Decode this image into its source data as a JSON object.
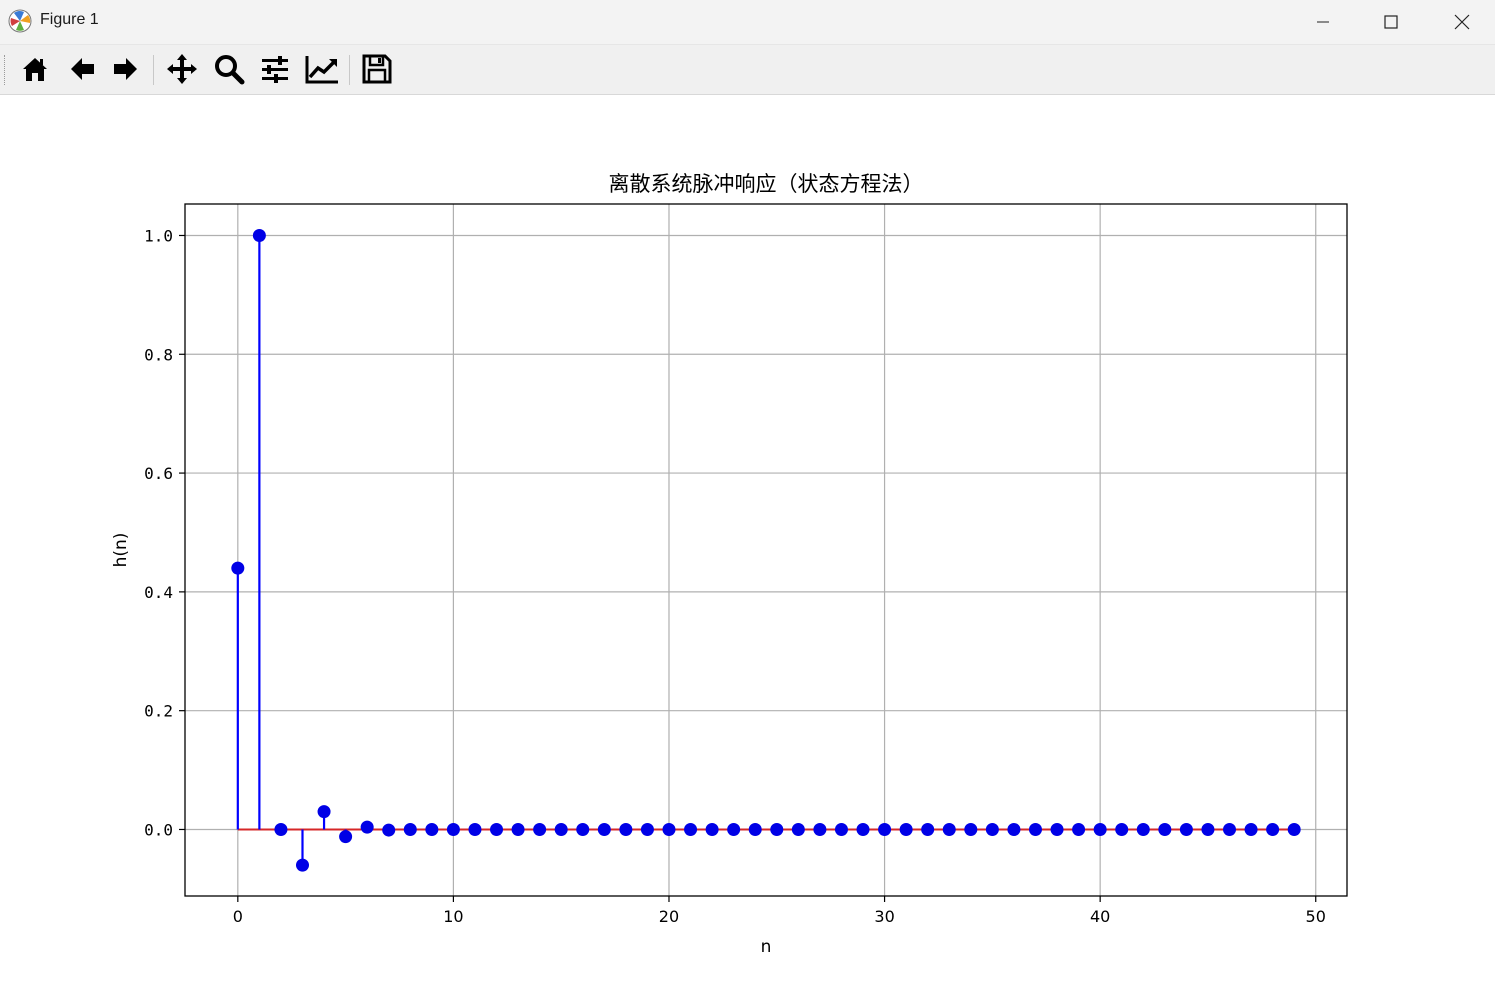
{
  "window": {
    "title": "Figure 1"
  },
  "toolbar": {
    "buttons": [
      {
        "name": "home-icon"
      },
      {
        "name": "back-arrow-icon"
      },
      {
        "name": "forward-arrow-icon"
      },
      {
        "name": "pan-move-icon"
      },
      {
        "name": "zoom-magnifier-icon"
      },
      {
        "name": "configure-subplots-icon"
      },
      {
        "name": "edit-axis-icon"
      },
      {
        "name": "save-floppy-icon"
      }
    ]
  },
  "chart_data": {
    "type": "stem",
    "title": "离散系统脉冲响应（状态方程法）",
    "xlabel": "n",
    "ylabel": "h(n)",
    "xlim": [
      -2.45,
      51.45
    ],
    "ylim": [
      -0.112,
      1.053
    ],
    "xticks": [
      0,
      10,
      20,
      30,
      40,
      50
    ],
    "xtick_labels": [
      "0",
      "10",
      "20",
      "30",
      "40",
      "50"
    ],
    "yticks": [
      0.0,
      0.2,
      0.4,
      0.6,
      0.8,
      1.0
    ],
    "ytick_labels": [
      "0.0",
      "0.2",
      "0.4",
      "0.6",
      "0.8",
      "1.0"
    ],
    "grid": true,
    "colors": {
      "stem": "#0000ff",
      "marker": "#0000e6",
      "baseline": "#d62728",
      "grid": "#b0b0b0"
    },
    "x": [
      0,
      1,
      2,
      3,
      4,
      5,
      6,
      7,
      8,
      9,
      10,
      11,
      12,
      13,
      14,
      15,
      16,
      17,
      18,
      19,
      20,
      21,
      22,
      23,
      24,
      25,
      26,
      27,
      28,
      29,
      30,
      31,
      32,
      33,
      34,
      35,
      36,
      37,
      38,
      39,
      40,
      41,
      42,
      43,
      44,
      45,
      46,
      47,
      48,
      49
    ],
    "y": [
      0.44,
      1.0,
      0.0,
      -0.06,
      0.03,
      -0.012,
      0.004,
      -0.001,
      0.0,
      0.0,
      0.0,
      0.0,
      0.0,
      0.0,
      0.0,
      0.0,
      0.0,
      0.0,
      0.0,
      0.0,
      0.0,
      0.0,
      0.0,
      0.0,
      0.0,
      0.0,
      0.0,
      0.0,
      0.0,
      0.0,
      0.0,
      0.0,
      0.0,
      0.0,
      0.0,
      0.0,
      0.0,
      0.0,
      0.0,
      0.0,
      0.0,
      0.0,
      0.0,
      0.0,
      0.0,
      0.0,
      0.0,
      0.0,
      0.0,
      0.0
    ]
  }
}
